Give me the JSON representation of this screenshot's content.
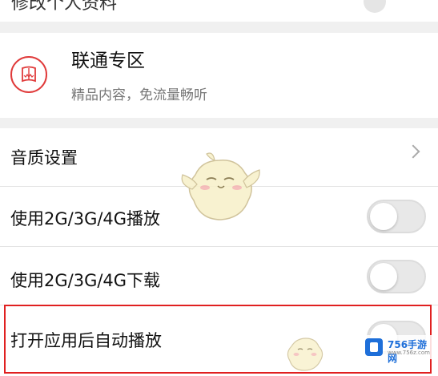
{
  "cut_row": {
    "text": "修改个人资料"
  },
  "unicom": {
    "title": "联通专区",
    "subtitle": "精品内容，免流量畅听"
  },
  "settings": {
    "items": [
      {
        "label": "音质设置",
        "control": "chevron"
      },
      {
        "label": "使用2G/3G/4G播放",
        "control": "toggle",
        "on": false
      },
      {
        "label": "使用2G/3G/4G下载",
        "control": "toggle",
        "on": false
      },
      {
        "label": "打开应用后自动播放",
        "control": "toggle",
        "on": false
      }
    ]
  },
  "watermark": {
    "text": "756手游网",
    "sub": "www.756z.com"
  },
  "colors": {
    "accent_red": "#e03a3a",
    "highlight_border": "#e02020"
  }
}
